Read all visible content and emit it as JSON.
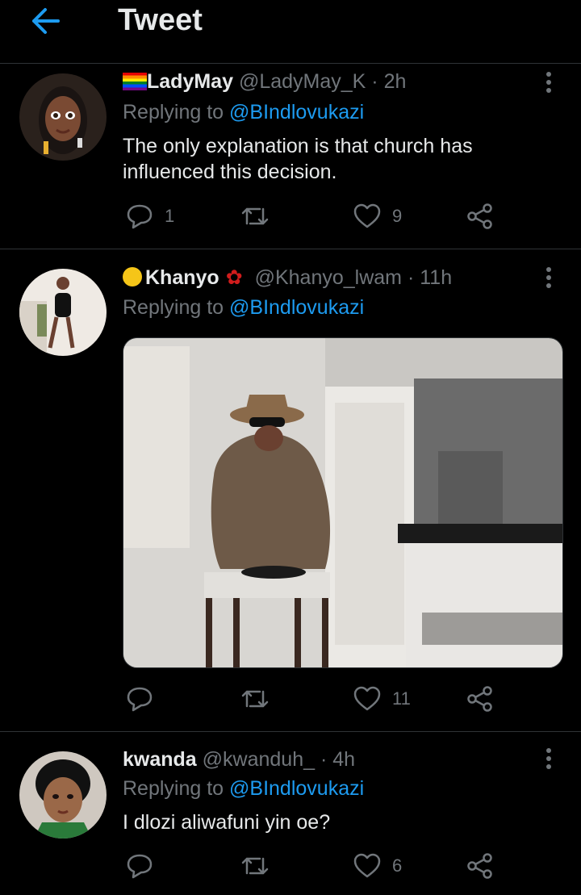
{
  "header": {
    "title": "Tweet",
    "back_icon": "arrow-left-icon",
    "accent": "#1d9bf0"
  },
  "tweets": [
    {
      "name": "LadyMay",
      "name_prefix_icon": "rainbow-flag-icon",
      "handle": "@LadyMay_K",
      "time": "· 2h",
      "replying_label": "Replying to",
      "replying_handle": "@BIndlovukazi",
      "text": "The only explanation is that church has influenced this decision.",
      "replies": "1",
      "retweets": "",
      "likes": "9"
    },
    {
      "name": "Khanyo",
      "name_prefix_icon": "yellow-disc-icon",
      "name_suffix_icon": "rose-icon",
      "handle": "@Khanyo_lwam",
      "time": "· 11h",
      "replying_label": "Replying to",
      "replying_handle": "@BIndlovukazi",
      "media": "photo",
      "replies": "",
      "retweets": "",
      "likes": "11"
    },
    {
      "name": "kwanda",
      "handle": "@kwanduh_",
      "time": "· 4h",
      "replying_label": "Replying to",
      "replying_handle": "@BIndlovukazi",
      "text": "I dlozi aliwafuni yin oe?",
      "replies": "",
      "retweets": "",
      "likes": "6"
    }
  ],
  "colors": {
    "background": "#000000",
    "text": "#e7e9ea",
    "secondary": "#71767b",
    "link": "#1d9bf0",
    "divider": "#2f3336"
  }
}
